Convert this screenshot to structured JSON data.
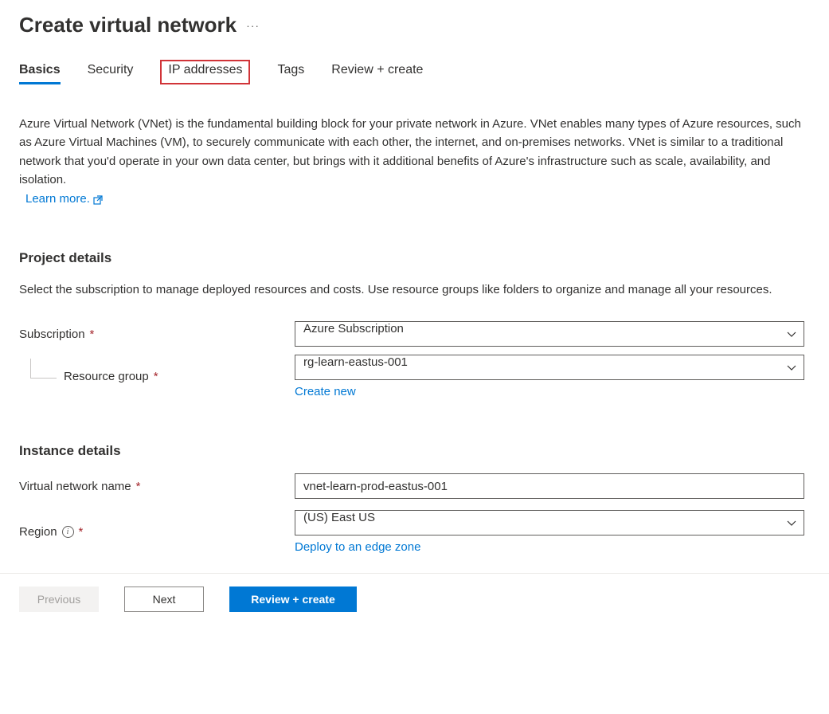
{
  "header": {
    "title": "Create virtual network"
  },
  "tabs": {
    "basics": "Basics",
    "security": "Security",
    "ip_addresses": "IP addresses",
    "tags": "Tags",
    "review_create": "Review + create"
  },
  "intro": {
    "text": "Azure Virtual Network (VNet) is the fundamental building block for your private network in Azure. VNet enables many types of Azure resources, such as Azure Virtual Machines (VM), to securely communicate with each other, the internet, and on-premises networks. VNet is similar to a traditional network that you'd operate in your own data center, but brings with it additional benefits of Azure's infrastructure such as scale, availability, and isolation.",
    "learn_more": "Learn more."
  },
  "project_details": {
    "title": "Project details",
    "description": "Select the subscription to manage deployed resources and costs. Use resource groups like folders to organize and manage all your resources.",
    "subscription_label": "Subscription",
    "subscription_value": "Azure Subscription",
    "resource_group_label": "Resource group",
    "resource_group_value": "rg-learn-eastus-001",
    "create_new": "Create new"
  },
  "instance_details": {
    "title": "Instance details",
    "vnet_name_label": "Virtual network name",
    "vnet_name_value": "vnet-learn-prod-eastus-001",
    "region_label": "Region",
    "region_value": "(US) East US",
    "deploy_edge": "Deploy to an edge zone"
  },
  "footer": {
    "previous": "Previous",
    "next": "Next",
    "review_create": "Review + create"
  }
}
